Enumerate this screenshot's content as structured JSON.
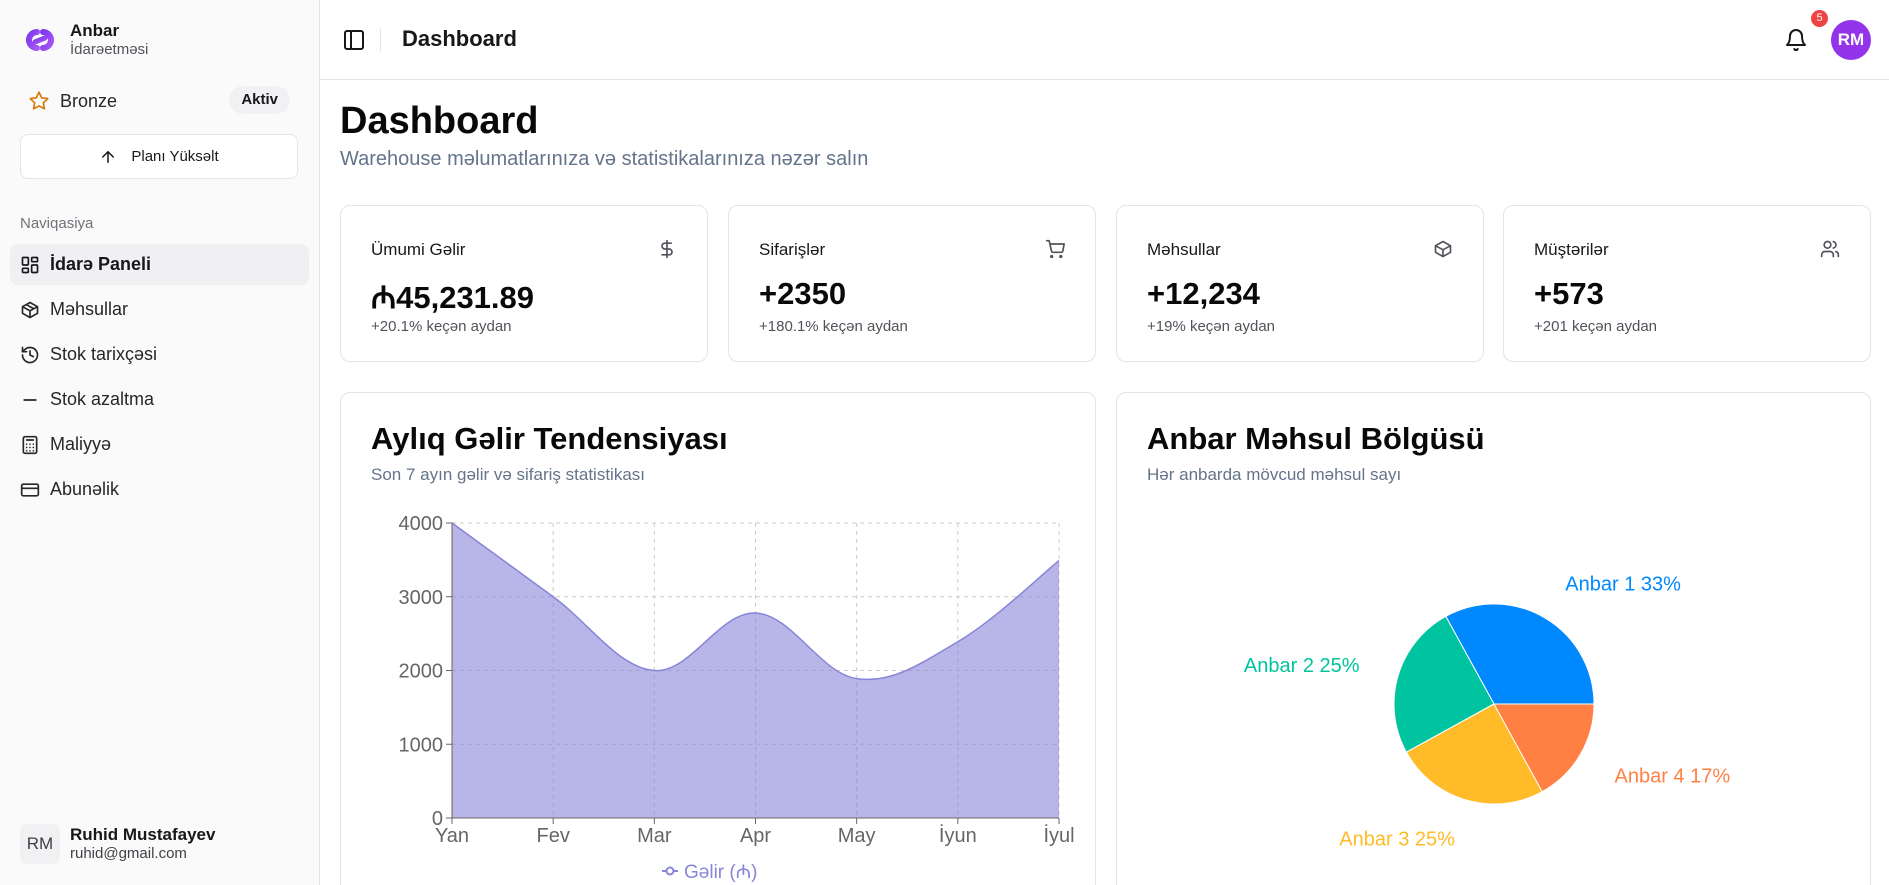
{
  "brand": {
    "name": "Anbar",
    "subtitle": "İdarəetməsi"
  },
  "plan": {
    "name": "Bronze",
    "status": "Aktiv",
    "upgrade_label": "Planı Yüksəlt"
  },
  "nav": {
    "heading": "Naviqasiya",
    "items": [
      {
        "label": "İdarə Paneli",
        "icon": "dashboard-icon",
        "active": true
      },
      {
        "label": "Məhsullar",
        "icon": "box-icon"
      },
      {
        "label": "Stok tarixçəsi",
        "icon": "history-icon"
      },
      {
        "label": "Stok azaltma",
        "icon": "minus-icon"
      },
      {
        "label": "Maliyyə",
        "icon": "calculator-icon"
      },
      {
        "label": "Abunəlik",
        "icon": "credit-card-icon"
      }
    ]
  },
  "user": {
    "initials": "RM",
    "name": "Ruhid Mustafayev",
    "email": "ruhid@gmail.com"
  },
  "header": {
    "title": "Dashboard",
    "notifications": "5",
    "avatar_initials": "RM",
    "avatar_color": "#9333ea"
  },
  "page": {
    "title": "Dashboard",
    "subtitle": "Warehouse məlumatlarınıza və statistikalarınıza nəzər salın"
  },
  "stats": [
    {
      "label": "Ümumi Gəlir",
      "value": "₼45,231.89",
      "change": "+20.1% keçən aydan",
      "icon": "dollar-icon"
    },
    {
      "label": "Sifarişlər",
      "value": "+2350",
      "change": "+180.1% keçən aydan",
      "icon": "cart-icon"
    },
    {
      "label": "Məhsullar",
      "value": "+12,234",
      "change": "+19% keçən aydan",
      "icon": "package-icon"
    },
    {
      "label": "Müştərilər",
      "value": "+573",
      "change": "+201 keçən aydan",
      "icon": "users-icon"
    }
  ],
  "revenue_card": {
    "title": "Aylıq Gəlir Tendensiyası",
    "subtitle": "Son 7 ayın gəlir və sifariş statistikası"
  },
  "warehouse_card": {
    "title": "Anbar Məhsul Bölgüsü",
    "subtitle": "Hər anbarda mövcud məhsul sayı"
  },
  "chart_data": [
    {
      "type": "area",
      "categories": [
        "Yan",
        "Fev",
        "Mar",
        "Apr",
        "May",
        "İyun",
        "İyul"
      ],
      "series": [
        {
          "name": "Gəlir (₼)",
          "values": [
            4000,
            3000,
            2000,
            2780,
            1890,
            2390,
            3490
          ],
          "color": "#8884d8"
        }
      ],
      "ylim": [
        0,
        4000
      ],
      "yticks": [
        0,
        1000,
        2000,
        3000,
        4000
      ],
      "grid": true,
      "legend": "bottom"
    },
    {
      "type": "pie",
      "slices": [
        {
          "label": "Anbar 1",
          "value": 33,
          "color": "#0088fe"
        },
        {
          "label": "Anbar 2",
          "value": 25,
          "color": "#00c49f"
        },
        {
          "label": "Anbar 3",
          "value": 25,
          "color": "#ffbb28"
        },
        {
          "label": "Anbar 4",
          "value": 17,
          "color": "#ff8042"
        }
      ]
    }
  ]
}
